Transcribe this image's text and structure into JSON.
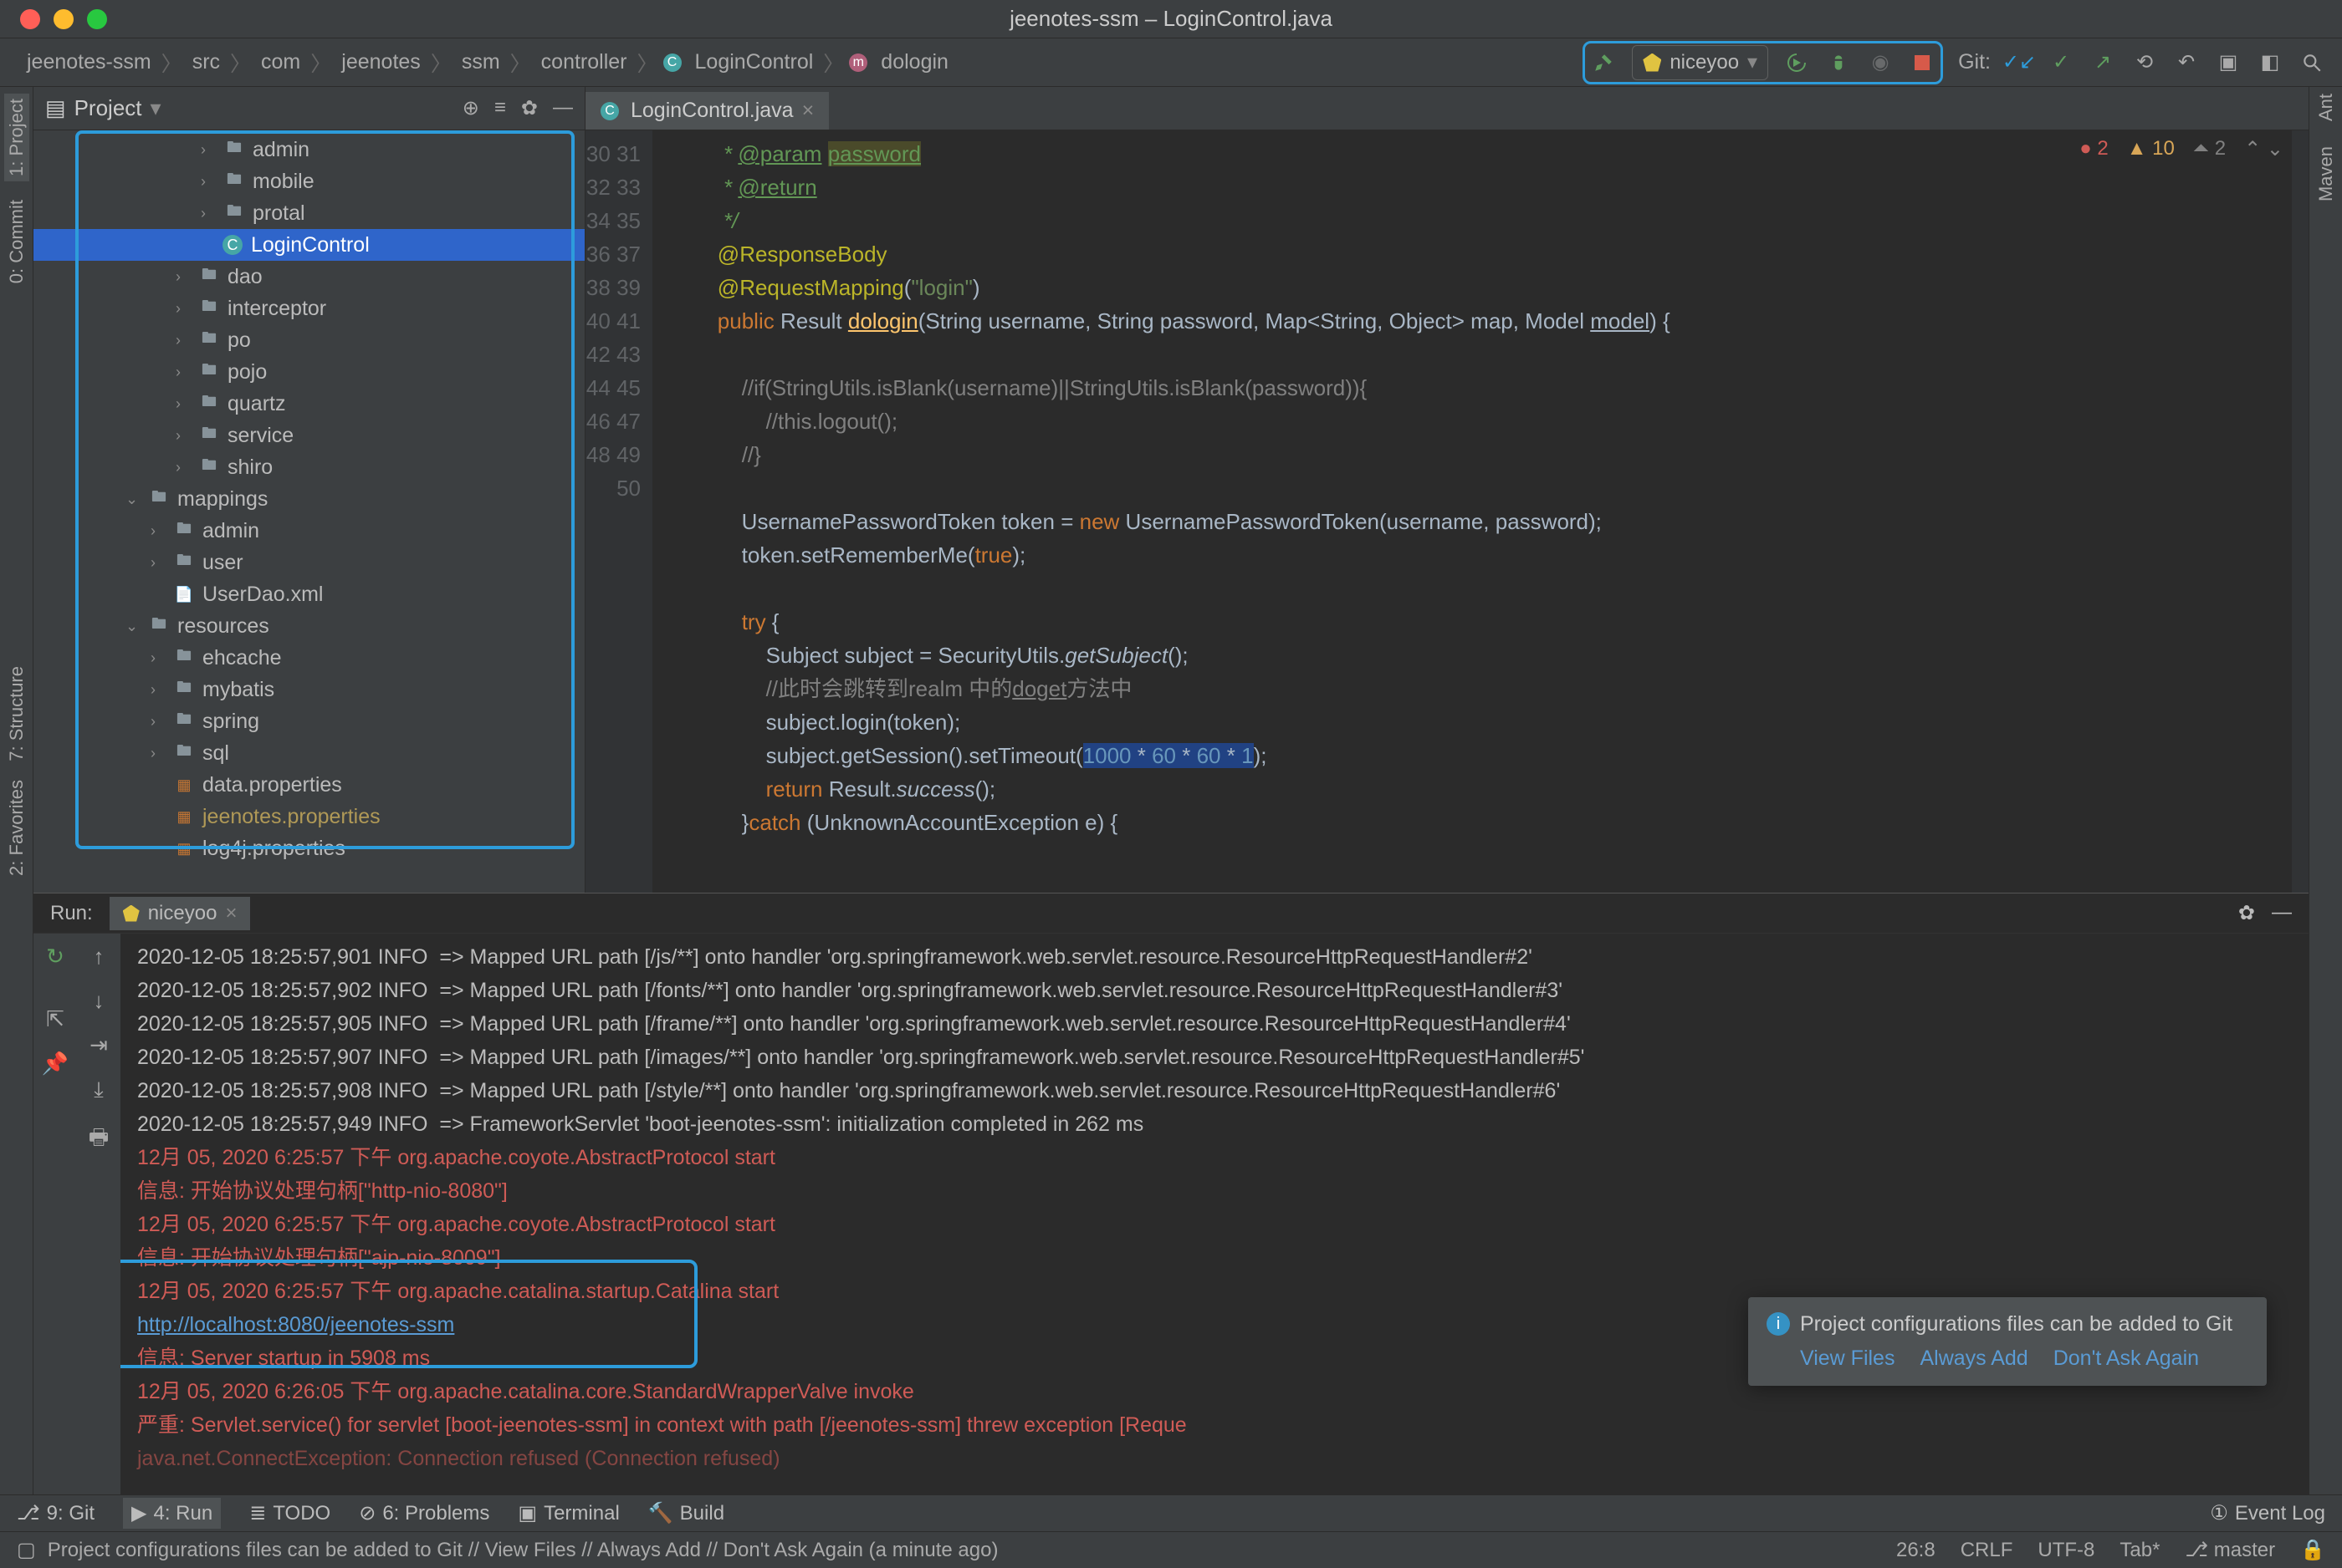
{
  "window_title": "jeenotes-ssm – LoginControl.java",
  "breadcrumb": [
    "jeenotes-ssm",
    "src",
    "com",
    "jeenotes",
    "ssm",
    "controller",
    "LoginControl",
    "dologin"
  ],
  "run_config_name": "niceyoo",
  "git_label": "Git:",
  "project_panel_title": "Project",
  "tree": {
    "admin": "admin",
    "mobile": "mobile",
    "protal": "protal",
    "LoginControl": "LoginControl",
    "dao": "dao",
    "interceptor": "interceptor",
    "po": "po",
    "pojo": "pojo",
    "quartz": "quartz",
    "service": "service",
    "shiro": "shiro",
    "mappings": "mappings",
    "m_admin": "admin",
    "m_user": "user",
    "UserDao": "UserDao.xml",
    "resources": "resources",
    "ehcache": "ehcache",
    "mybatis": "mybatis",
    "spring": "spring",
    "sql": "sql",
    "data_prop": "data.properties",
    "jee_prop": "jeenotes.properties",
    "log4j_prop": "log4j.properties"
  },
  "tab_name": "LoginControl.java",
  "inspections": {
    "errors": "2",
    "warnings": "10",
    "weak": "2"
  },
  "gutter_start": 30,
  "gutter_end": 50,
  "code_lines": [
    {
      "t": " * ",
      "spans": [
        {
          "c": "doc"
        }
      ],
      "post": [
        {
          "t": "@param",
          "c": "docu"
        },
        {
          "t": " ",
          "c": ""
        },
        {
          "t": "password",
          "c": "pw-str docu"
        }
      ]
    },
    {
      "t": " * ",
      "spans": [
        {
          "c": "doc"
        }
      ],
      "post": [
        {
          "t": "@return",
          "c": "docu"
        }
      ]
    },
    {
      "t": " */",
      "c": "doc"
    },
    {
      "raw": "<span class='ann'>@ResponseBody</span>"
    },
    {
      "raw": "<span class='ann'>@RequestMapping</span>(<span class='str'>\"login\"</span>)"
    },
    {
      "raw": "<span class='kw'>public</span> Result <span class='fn und'>dologin</span>(String username, String password, Map&lt;String, Object&gt; map, Model <span class='und'>model</span>) {"
    },
    {
      "raw": ""
    },
    {
      "raw": "    <span class='com'>//if(StringUtils.isBlank(username)||StringUtils.isBlank(password)){</span>"
    },
    {
      "raw": "        <span class='com'>//this.logout();</span>"
    },
    {
      "raw": "    <span class='com'>//}</span>"
    },
    {
      "raw": ""
    },
    {
      "raw": "    UsernamePasswordToken token = <span class='kw'>new</span> UsernamePasswordToken(username, password);"
    },
    {
      "raw": "    token.setRememberMe(<span class='kw'>true</span>);"
    },
    {
      "raw": ""
    },
    {
      "raw": "    <span class='kw'>try</span> {"
    },
    {
      "raw": "        Subject subject = SecurityUtils.<span class='ital'>getSubject</span>();"
    },
    {
      "raw": "        <span class='com'>//此时会跳转到realm 中的<span class='und'>doget</span>方法中</span>"
    },
    {
      "raw": "        subject.login(token);"
    },
    {
      "raw": "        subject.getSession().setTimeout(<span class='sel-span'><span class='num'>1000</span> * <span class='num'>60</span> * <span class='num'>60</span> * <span class='num'>1</span></span>);"
    },
    {
      "raw": "        <span class='kw'>return</span> Result.<span class='ital'>success</span>();"
    },
    {
      "raw": "    }<span class='kw'>catch</span> (UnknownAccountException e) {"
    }
  ],
  "run_label": "Run:",
  "run_tab": "niceyoo",
  "console": [
    {
      "t": "2020-12-05 18:25:57,901 INFO  => Mapped URL path [/js/**] onto handler 'org.springframework.web.servlet.resource.ResourceHttpRequestHandler#2'"
    },
    {
      "t": "2020-12-05 18:25:57,902 INFO  => Mapped URL path [/fonts/**] onto handler 'org.springframework.web.servlet.resource.ResourceHttpRequestHandler#3'"
    },
    {
      "t": "2020-12-05 18:25:57,905 INFO  => Mapped URL path [/frame/**] onto handler 'org.springframework.web.servlet.resource.ResourceHttpRequestHandler#4'"
    },
    {
      "t": "2020-12-05 18:25:57,907 INFO  => Mapped URL path [/images/**] onto handler 'org.springframework.web.servlet.resource.ResourceHttpRequestHandler#5'"
    },
    {
      "t": "2020-12-05 18:25:57,908 INFO  => Mapped URL path [/style/**] onto handler 'org.springframework.web.servlet.resource.ResourceHttpRequestHandler#6'"
    },
    {
      "t": "2020-12-05 18:25:57,949 INFO  => FrameworkServlet 'boot-jeenotes-ssm': initialization completed in 262 ms"
    },
    {
      "t": "12月 05, 2020 6:25:57 下午 org.apache.coyote.AbstractProtocol start",
      "c": "red"
    },
    {
      "t": "信息: 开始协议处理句柄[\"http-nio-8080\"]",
      "c": "red"
    },
    {
      "t": "12月 05, 2020 6:25:57 下午 org.apache.coyote.AbstractProtocol start",
      "c": "red"
    },
    {
      "t": "信息: 开始协议处理句柄[\"ajp-nio-8009\"]",
      "c": "red"
    },
    {
      "t": "12月 05, 2020 6:25:57 下午 org.apache.catalina.startup.Catalina start",
      "c": "red"
    },
    {
      "link": "http://localhost:8080/jeenotes-ssm"
    },
    {
      "t": "信息: Server startup in 5908 ms",
      "c": "red"
    },
    {
      "t": "12月 05, 2020 6:26:05 下午 org.apache.catalina.core.StandardWrapperValve invoke",
      "c": "red"
    },
    {
      "t": "严重: Servlet.service() for servlet [boot-jeenotes-ssm] in context with path [/jeenotes-ssm] threw exception [Reque",
      "c": "red"
    },
    {
      "t": "java.net.ConnectException: Connection refused (Connection refused)",
      "c": "red",
      "dim": true
    }
  ],
  "notification": {
    "text": "Project configurations files can be added to Git",
    "links": [
      "View Files",
      "Always Add",
      "Don't Ask Again"
    ]
  },
  "bottom_tools": {
    "git": "9: Git",
    "run": "4: Run",
    "todo": "TODO",
    "problems": "6: Problems",
    "terminal": "Terminal",
    "build": "Build",
    "event_log": "Event Log"
  },
  "status_bar": {
    "msg": "Project configurations files can be added to Git // View Files // Always Add // Don't Ask Again (a minute ago)",
    "pos": "26:8",
    "crlf": "CRLF",
    "enc": "UTF-8",
    "tab": "Tab*",
    "branch": "master"
  },
  "left_tabs": {
    "project": "1: Project",
    "commit": "0: Commit"
  },
  "right_tabs": {
    "ant": "Ant",
    "maven": "Maven"
  },
  "left_collapsed": {
    "structure": "7: Structure",
    "favorites": "2: Favorites"
  }
}
